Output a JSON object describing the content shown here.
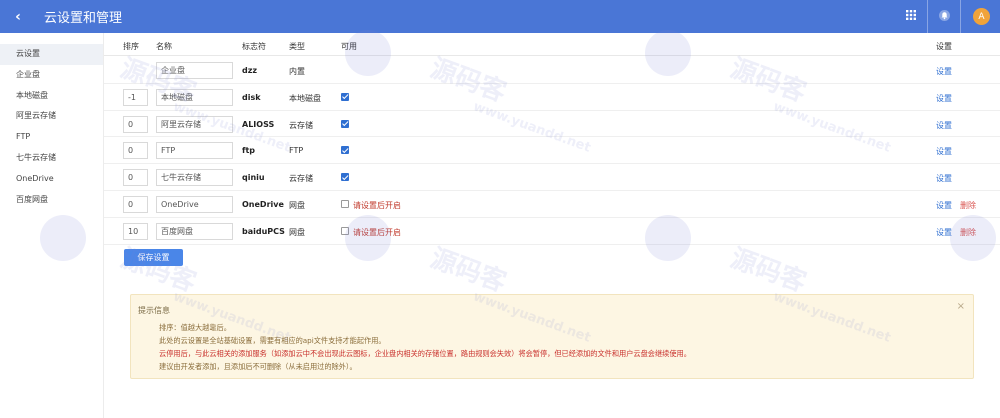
{
  "header": {
    "back_label": "‹",
    "title": "云设置和管理",
    "avatar_letter": "A",
    "icons": [
      "grid-icon",
      "bell-icon"
    ]
  },
  "sidebar": {
    "items": [
      {
        "label": "云设置",
        "active": true
      },
      {
        "label": "企业盘"
      },
      {
        "label": "本地磁盘"
      },
      {
        "label": "阿里云存储"
      },
      {
        "label": "FTP"
      },
      {
        "label": "七牛云存储"
      },
      {
        "label": "OneDrive"
      },
      {
        "label": "百度网盘"
      }
    ]
  },
  "table": {
    "headers": {
      "order": "排序",
      "name": "名称",
      "flag": "标志符",
      "type": "类型",
      "enabled": "可用",
      "settings": "设置"
    },
    "rows": [
      {
        "order": "",
        "name": "企业盘",
        "flag": "dzz",
        "type": "内置",
        "checkbox": "none",
        "settings": "设置"
      },
      {
        "order": "-1",
        "name": "本地磁盘",
        "flag": "disk",
        "type": "本地磁盘",
        "checkbox": "on",
        "settings": "设置"
      },
      {
        "order": "0",
        "name": "阿里云存储",
        "flag": "ALIOSS",
        "type": "云存储",
        "checkbox": "on",
        "settings": "设置"
      },
      {
        "order": "0",
        "name": "FTP",
        "flag": "ftp",
        "type": "FTP",
        "checkbox": "on",
        "settings": "设置"
      },
      {
        "order": "0",
        "name": "七牛云存储",
        "flag": "qiniu",
        "type": "云存储",
        "checkbox": "on",
        "settings": "设置"
      },
      {
        "order": "0",
        "name": "OneDrive",
        "flag": "OneDrive",
        "type": "网盘",
        "checkbox": "off",
        "hint": "请设置后开启",
        "settings": "设置",
        "delete": "删除"
      },
      {
        "order": "10",
        "name": "百度网盘",
        "flag": "baiduPCS",
        "type": "网盘",
        "checkbox": "off",
        "hint": "请设置后开启",
        "settings": "设置",
        "delete": "删除"
      }
    ]
  },
  "save_button": "保存设置",
  "alert": {
    "title": "提示信息",
    "close": "×",
    "lines": [
      {
        "text": "排序：值越大越靠后。",
        "red": false
      },
      {
        "text": "此处的云设置是全站基础设置，需要有相应的api文件支持才能起作用。",
        "red": false
      },
      {
        "text": "云停用后，与此云相关的添加服务（如添加云中不会出现此云图标，企业盘内相关的存储位置，路由规则会失效）将会暂停，但已经添加的文件和用户云盘会继续使用。",
        "red": true
      },
      {
        "text": "建议由开发者添加，且添加后不可删除（从未启用过的除外）。",
        "red": false
      }
    ]
  },
  "watermark": {
    "text": "源码客",
    "url": "www.yuandd.net"
  }
}
